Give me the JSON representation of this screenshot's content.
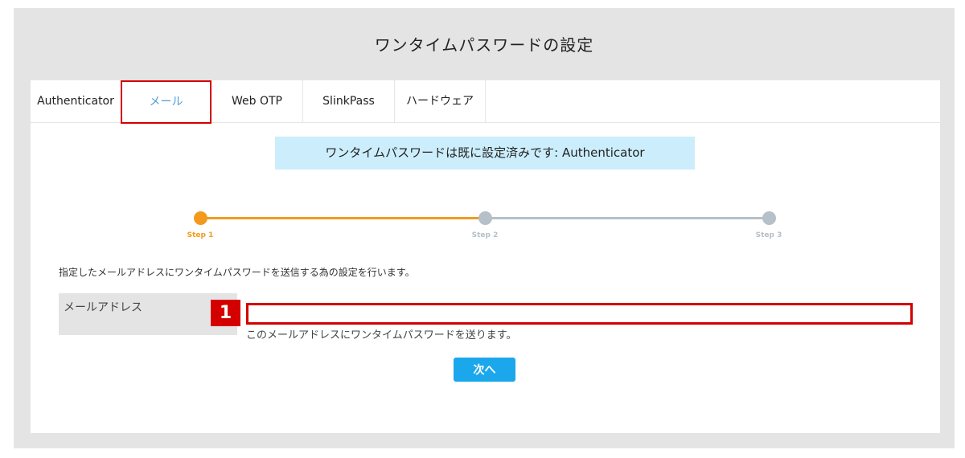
{
  "header": {
    "title": "ワンタイムパスワードの設定"
  },
  "tabs": [
    {
      "label": "Authenticator",
      "active": false
    },
    {
      "label": "メール",
      "active": true
    },
    {
      "label": "Web OTP",
      "active": false
    },
    {
      "label": "SlinkPass",
      "active": false
    },
    {
      "label": "ハードウェア",
      "active": false
    }
  ],
  "notice": {
    "text": "ワンタイムパスワードは既に設定済みです: Authenticator"
  },
  "stepper": {
    "current_step": 1,
    "steps": [
      {
        "label": "Step 1",
        "state": "current"
      },
      {
        "label": "Step 2",
        "state": "pending"
      },
      {
        "label": "Step 3",
        "state": "pending"
      }
    ],
    "colors": {
      "done": "#f39a1e",
      "pending": "#b5c0c8"
    }
  },
  "form": {
    "instruction": "指定したメールアドレスにワンタイムパスワードを送信する為の設定を行います。",
    "email": {
      "label": "メールアドレス",
      "value": "",
      "placeholder": "",
      "helper": "このメールアドレスにワンタイムパスワードを送ります。"
    },
    "next_label": "次へ"
  },
  "annotation": {
    "marker": "1",
    "color": "#d40000"
  },
  "colors": {
    "accent": "#1aa7ec",
    "active_tab_text": "#4a9fd8",
    "notice_bg": "#cceefc"
  }
}
